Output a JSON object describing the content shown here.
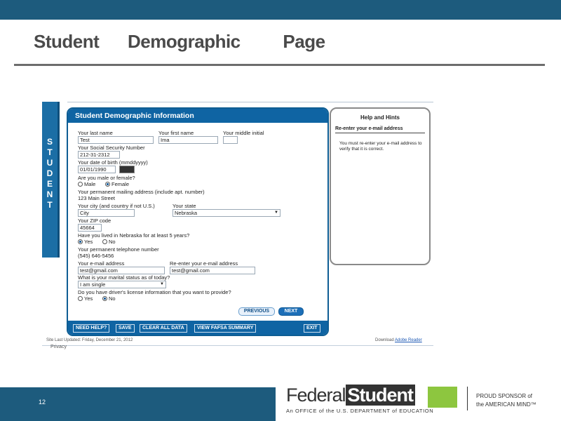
{
  "slide": {
    "title_words": [
      "Student",
      "Demographic",
      "Page"
    ],
    "page_number": "12"
  },
  "side_tab": {
    "letters": [
      "S",
      "T",
      "U",
      "D",
      "E",
      "N",
      "T"
    ]
  },
  "form": {
    "header": "Student Demographic Information",
    "last_name_label": "Your last name",
    "last_name_value": "Test",
    "first_name_label": "Your first name",
    "first_name_value": "Ima",
    "middle_initial_label": "Your middle initial",
    "middle_initial_value": "",
    "ssn_label": "Your Social Security Number",
    "ssn_value": "212-31-2312",
    "dob_label": "Your date of birth (mmddyyyy)",
    "dob_value": "01/01/1990",
    "gender_label": "Are you male or female?",
    "gender_options": [
      "Male",
      "Female"
    ],
    "gender_selected": "Female",
    "address_label": "Your permanent mailing address (include apt. number)",
    "address_value": "123 Main Street",
    "city_label": "Your city (and country if not U.S.)",
    "city_value": "City",
    "state_label": "Your state",
    "state_value": "Nebraska",
    "zip_label": "Your ZIP code",
    "zip_value": "45664",
    "lived_label": "Have you lived in Nebraska for at least 5 years?",
    "lived_options": [
      "Yes",
      "No"
    ],
    "lived_selected": "Yes",
    "phone_label": "Your permanent telephone number",
    "phone_value": "(545) 646-5456",
    "email_label": "Your e-mail address",
    "email_value": "test@gmail.com",
    "reemail_label": "Re-enter your e-mail address",
    "reemail_value": "test@gmail.com",
    "marital_label": "What is your marital status as of today?",
    "marital_value": "I am single",
    "license_label": "Do you have driver's license information that you want to provide?",
    "license_options": [
      "Yes",
      "No"
    ],
    "license_selected": "No",
    "previous_button": "PREVIOUS",
    "next_button": "NEXT",
    "footer_buttons": {
      "need_help": "NEED HELP?",
      "save": "SAVE",
      "clear_all": "CLEAR ALL DATA",
      "view_summary": "VIEW FAFSA SUMMARY",
      "exit": "EXIT"
    }
  },
  "hints": {
    "title": "Help and Hints",
    "subtitle": "Re-enter your e-mail address",
    "body": "You must re-enter your e-mail address to verify that it is correct."
  },
  "page_footer": {
    "updated": "Site Last Updated: Friday, December 21, 2012",
    "privacy": "Privacy",
    "download_prefix": "Download",
    "download_link": "Adobe Reader"
  },
  "logo": {
    "federal": "Federal",
    "student": "Student",
    "tagline": "An OFFICE of the U.S. DEPARTMENT of EDUCATION",
    "sponsor_line1": "PROUD SPONSOR of",
    "sponsor_line2": "the AMERICAN MIND™"
  },
  "colors": {
    "brand_blue": "#1d5b7d",
    "form_blue": "#0f64a3",
    "logo_green": "#8dc63f"
  }
}
